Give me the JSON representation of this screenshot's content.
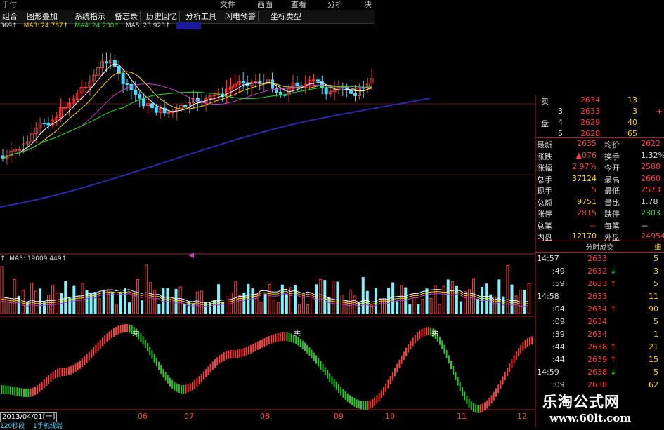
{
  "menu": [
    "于付",
    "文件",
    "画面",
    "查看",
    "分析",
    "决"
  ],
  "toolbar": [
    "组合",
    "图形叠加",
    "系统指示",
    "备忘录",
    "历史回忆",
    "分析工具",
    "闪电预警",
    "坐标类型"
  ],
  "ma_bar": {
    "ma2": "369↑",
    "ma3_label": "MA3:",
    "ma3": "24.767↑",
    "ma4_label": "MA4:",
    "ma4": "24.230↑",
    "ma5_label": "MA5:",
    "ma5": "23.923↑"
  },
  "volume_ma": {
    "label": "MA3:",
    "value": "19009.449↑"
  },
  "quote_panel": {
    "order_book": [
      {
        "label": "卖",
        "level": "",
        "price": "2634",
        "vol": "13",
        "chg": ""
      },
      {
        "label": "",
        "level": "3",
        "price": "2633",
        "vol": "3",
        "chg": "+"
      },
      {
        "label": "盘",
        "level": "4",
        "price": "2629",
        "vol": "40",
        "chg": ""
      },
      {
        "label": "",
        "level": "5",
        "price": "2628",
        "vol": "65",
        "chg": ""
      }
    ],
    "stats": [
      {
        "k1": "最新",
        "v1": "2635",
        "k2": "均价",
        "v2": "2622"
      },
      {
        "k1": "涨跌",
        "v1": "▲076",
        "k2": "换手",
        "v2": "1.32%"
      },
      {
        "k1": "涨幅",
        "v1": "2.97%",
        "k2": "今开",
        "v2": "2588"
      },
      {
        "k1": "总手",
        "v1": "37124",
        "k2": "最高",
        "v2": "2660"
      },
      {
        "k1": "现手",
        "v1": "5",
        "k2": "最低",
        "v2": "2573"
      },
      {
        "k1": "总额",
        "v1": "9751",
        "k2": "量比",
        "v2": "1.78"
      },
      {
        "k1": "涨停",
        "v1": "2815",
        "k2": "跌停",
        "v2": "2303"
      },
      {
        "k1": "总笔",
        "v1": "－",
        "k2": "每笔",
        "v2": "－"
      },
      {
        "k1": "内盘",
        "v1": "12170",
        "k2": "外盘",
        "v2": "24954"
      }
    ],
    "ticks_title": "分时成交",
    "ticks_tab": "细",
    "ticks": [
      {
        "time": "14:57",
        "price": "2633",
        "arrow": "",
        "vol": "5"
      },
      {
        "time": ":49",
        "price": "2632",
        "arrow": "↓",
        "vol": "3"
      },
      {
        "time": ":59",
        "price": "2633",
        "arrow": "↑",
        "vol": "5"
      },
      {
        "time": "14:58",
        "price": "2633",
        "arrow": "",
        "vol": "11"
      },
      {
        "time": ":04",
        "price": "2634",
        "arrow": "↑",
        "vol": "90"
      },
      {
        "time": ":09",
        "price": "2634",
        "arrow": "",
        "vol": "5"
      },
      {
        "time": ":39",
        "price": "2634",
        "arrow": "",
        "vol": "1"
      },
      {
        "time": ":44",
        "price": "2638",
        "arrow": "↑",
        "vol": "21"
      },
      {
        "time": ":44",
        "price": "2639",
        "arrow": "↑",
        "vol": "15"
      },
      {
        "time": "14:59",
        "price": "2638",
        "arrow": "↓",
        "vol": "5"
      },
      {
        "time": ":09",
        "price": "2638",
        "arrow": "",
        "vol": "62"
      }
    ]
  },
  "date_box": "2013/04/01[一]",
  "bottom_label": "120秒段 　1手机线端",
  "months": [
    "06",
    "07",
    "08",
    "09",
    "10",
    "11",
    "12"
  ],
  "sell_marker": "卖",
  "watermark": {
    "line1": "乐淘公式网",
    "line2": "www.60lt.com"
  },
  "colors": {
    "up": "#ff3b3b",
    "down": "#4fd8ff",
    "signal_up": "#ff3b3b",
    "signal_down": "#22cc22",
    "ma_long": "#2a2aa8"
  }
}
